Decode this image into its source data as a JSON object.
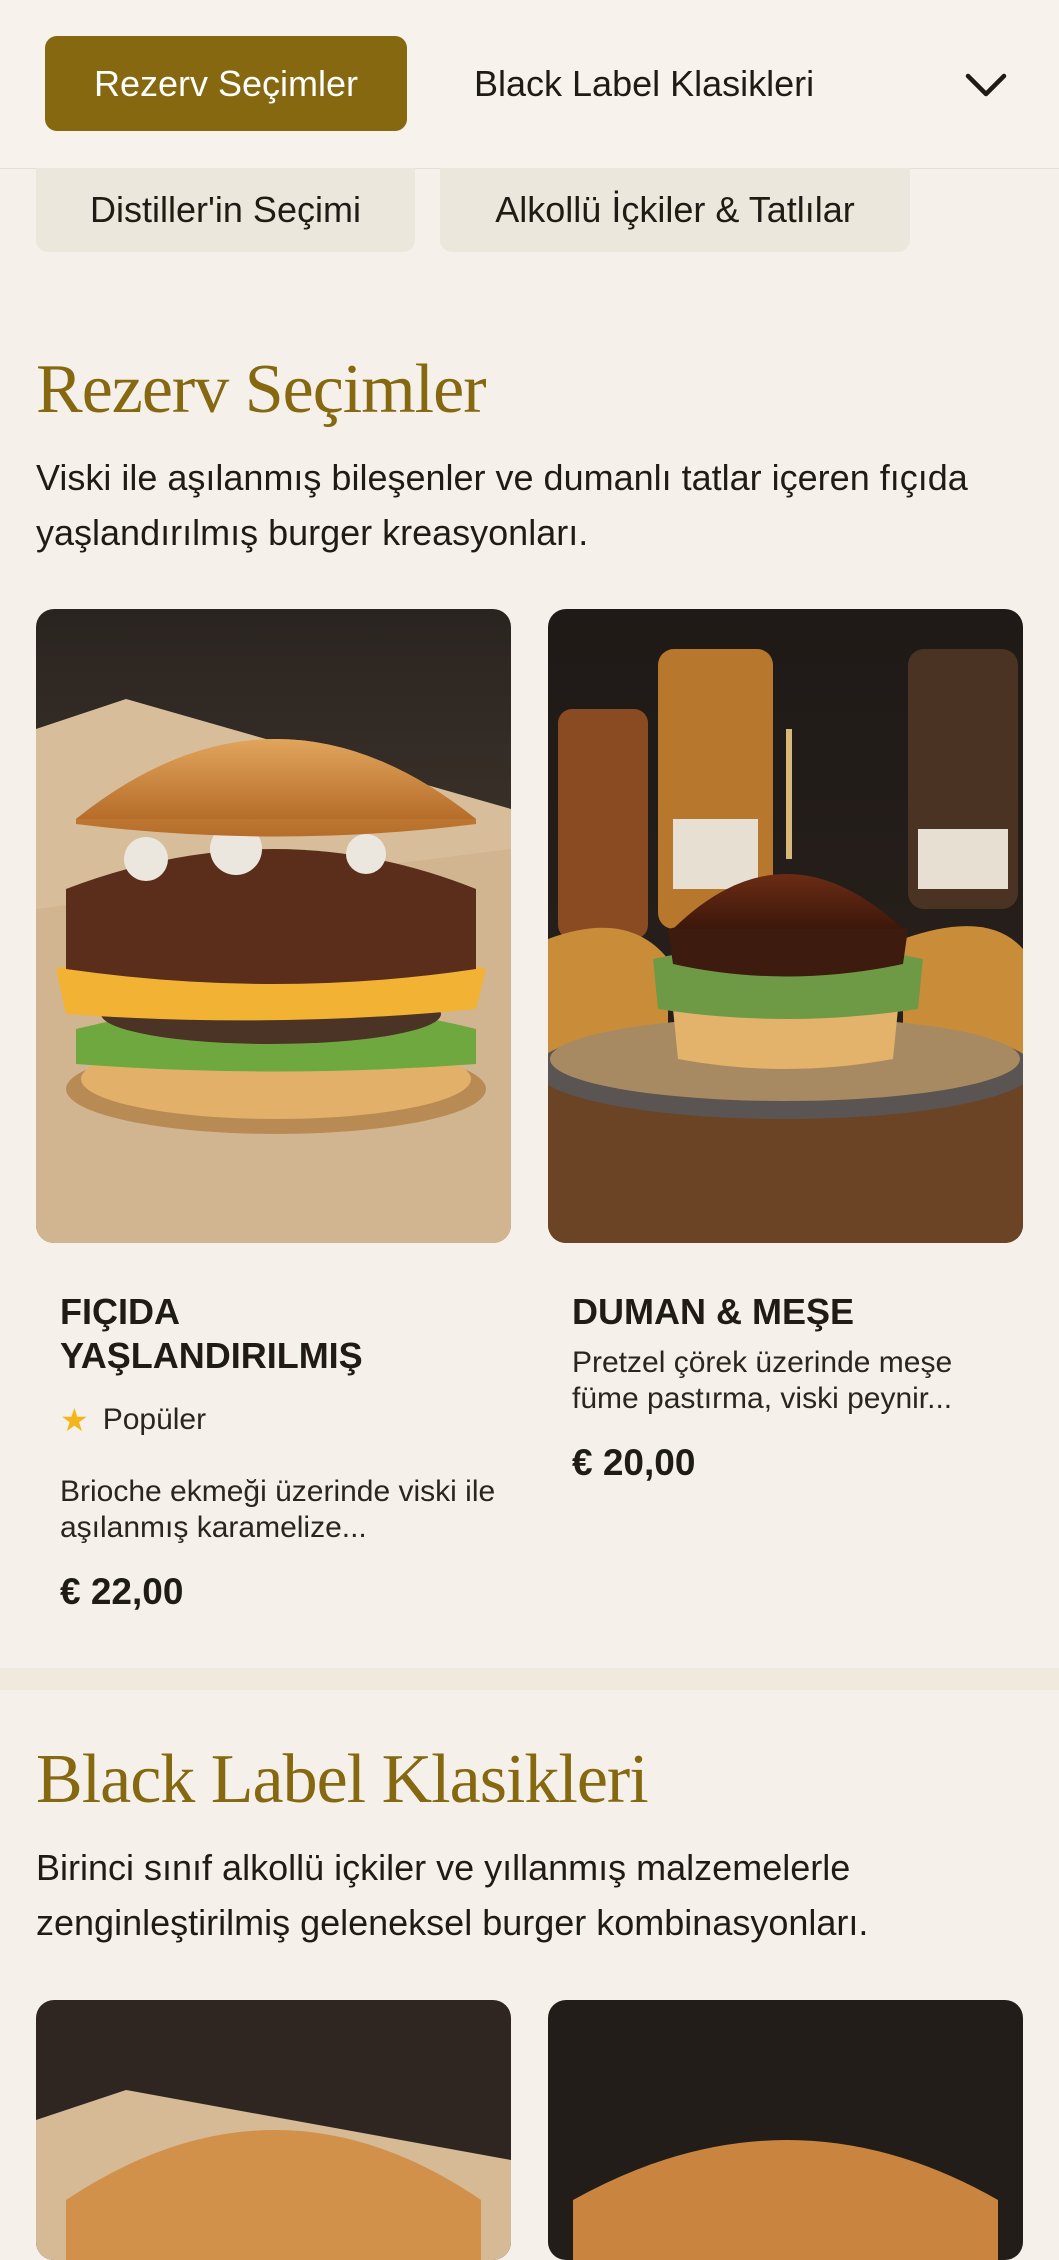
{
  "nav": {
    "active_category": "Rezerv Seçimler",
    "next_category": "Black Label Klasikleri",
    "row_categories": [
      "Distiller'in Seçimi",
      "Alkollü İçkiler & Tatlılar"
    ]
  },
  "sections": [
    {
      "title": "Rezerv Seçimler",
      "description": "Viski ile aşılanmış bileşenler ve dumanlı tatlar içeren fıçıda yaşlandırılmış burger kreasyonları.",
      "items": [
        {
          "name": "FIÇIDA YAŞLANDIRILMIŞ",
          "badge": "Popüler",
          "description": "Brioche ekmeği üzerinde viski ile aşılanmış karamelize...",
          "price": "€ 22,00"
        },
        {
          "name": "DUMAN & MEŞE",
          "description": "Pretzel çörek üzerinde meşe füme pastırma, viski peynir...",
          "price": "€ 20,00"
        }
      ]
    },
    {
      "title": "Black Label Klasikleri",
      "description": "Birinci sınıf alkollü içkiler ve yıllanmış malzemelerle zenginleştirilmiş geleneksel burger kombinasyonları."
    }
  ],
  "colors": {
    "accent": "#85680f",
    "background": "#f5f1ea",
    "chip": "#ece7dc",
    "star": "#f3b51a"
  },
  "icons": [
    "chevron-down-icon",
    "star-icon"
  ]
}
